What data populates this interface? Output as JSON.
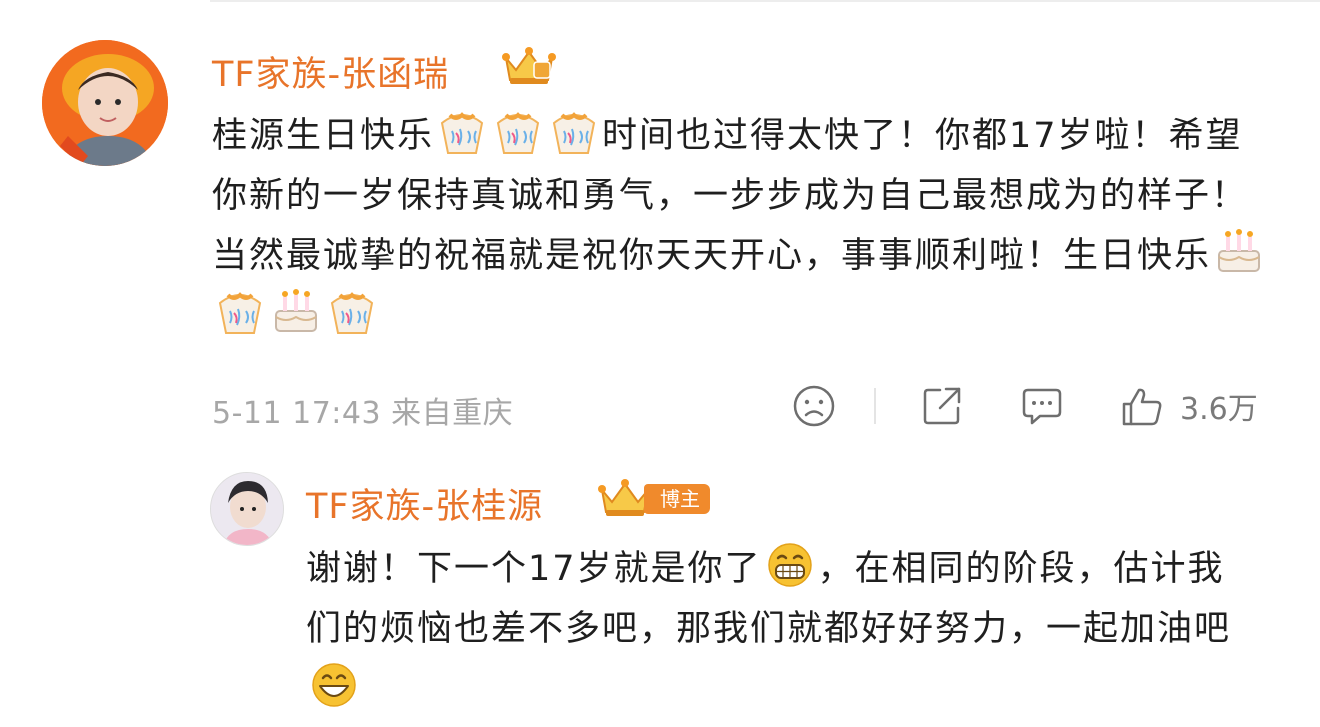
{
  "comment": {
    "author": "TF家族-张函瑞",
    "text_parts": [
      "桂源生日快乐",
      "时间也过得太快了！你都17岁啦！希望你新的一岁保持真诚和勇气，一步步成为自己最想成为的样子！当然最诚挚的祝福就是祝你天天开心，事事顺利啦！生日快乐"
    ],
    "emojis": [
      "party-popper",
      "party-popper",
      "party-popper",
      "birthday-cake",
      "party-popper",
      "birthday-cake",
      "party-popper"
    ],
    "timestamp": "5-11 17:43",
    "location": "来自重庆",
    "like_count": "3.6万"
  },
  "reply": {
    "author": "TF家族-张桂源",
    "author_tag": "博主",
    "text_parts": [
      "谢谢！下一个17岁就是你了",
      "，在相同的阶段，估计我们的烦恼也差不多吧，那我们就都好好努力，一起加油吧"
    ],
    "emojis": [
      "grinning-face",
      "smiling-face"
    ]
  },
  "colors": {
    "name": "#e8742a",
    "meta": "#a7a7a7",
    "tag_bg": "#f08a2c"
  }
}
